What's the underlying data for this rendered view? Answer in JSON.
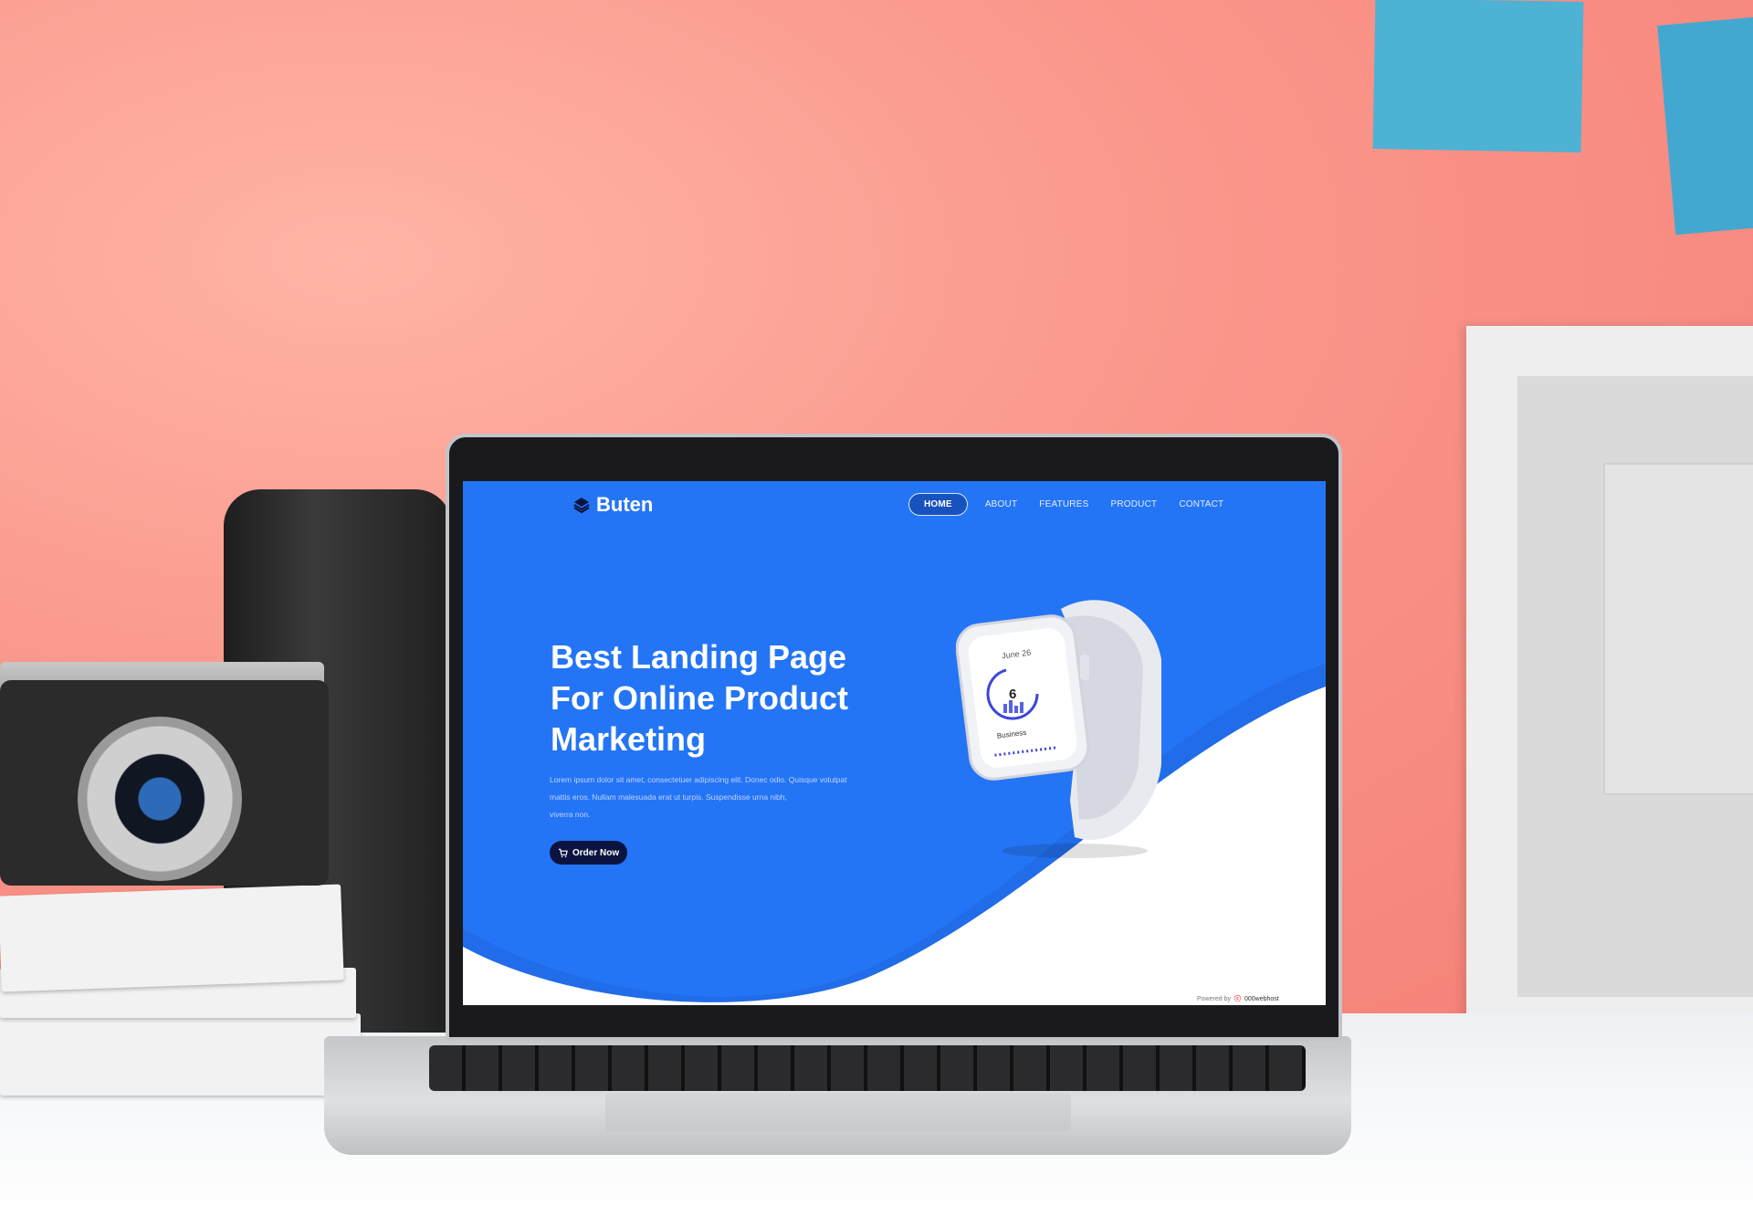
{
  "website": {
    "brand": {
      "name": "Buten"
    },
    "nav": {
      "items": [
        {
          "label": "HOME",
          "active": true
        },
        {
          "label": "ABOUT",
          "active": false
        },
        {
          "label": "FEATURES",
          "active": false
        },
        {
          "label": "PRODUCT",
          "active": false
        },
        {
          "label": "CONTACT",
          "active": false
        }
      ]
    },
    "hero": {
      "title_line1": "Best Landing Page",
      "title_line2": "For Online Product",
      "title_line3": "Marketing",
      "body_line1": "Lorem ipsum dolor sit amet, consectetuer adipiscing elit. Donec odio. Quisque volutpat",
      "body_line2": "mattis eros. Nullam malesuada erat ut turpis. Suspendisse urna nibh,",
      "body_line3": "viverra non.",
      "cta_label": "Order Now"
    },
    "watch": {
      "date": "June 26",
      "value": "6",
      "label": "Business"
    },
    "footer_badge": {
      "prefix": "Powered by",
      "host": "000webhost"
    },
    "colors": {
      "primary": "#2475f5",
      "dark": "#0b1440",
      "wave": "#ffffff"
    }
  }
}
